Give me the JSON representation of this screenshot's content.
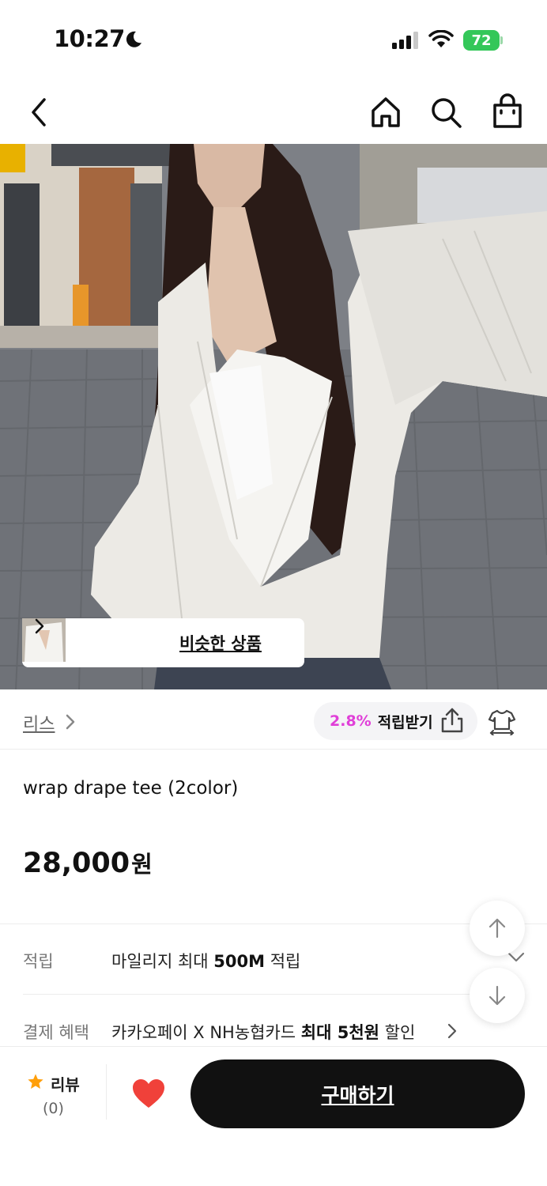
{
  "status_bar": {
    "time": "10:27",
    "battery": "72"
  },
  "nav": {
    "back_icon": "chevron-left-icon",
    "home_icon": "home-icon",
    "search_icon": "search-icon",
    "cart_icon": "shopping-bag-icon"
  },
  "hero": {
    "similar_label": "비슷한 상품"
  },
  "brand_row": {
    "brand": "리스",
    "reward_percent": "2.8%",
    "reward_label": "적립받기"
  },
  "product": {
    "title": "wrap drape tee (2color)",
    "price": "28,000",
    "currency": "원"
  },
  "info_rows": [
    {
      "key": "적립",
      "value_pre": "마일리지 최대 ",
      "value_bold": "500M",
      "value_post": " 적립"
    },
    {
      "key": "결제 혜택",
      "value_pre": "카카오페이 X NH농협카드 ",
      "value_bold": "최대 5천원",
      "value_post": " 할인"
    }
  ],
  "bottom_bar": {
    "review_label": "리뷰",
    "review_count": "(0)",
    "buy_label": "구매하기"
  },
  "colors": {
    "accent_pink": "#e03fd8",
    "heart_red": "#f0413a",
    "star_orange": "#ff9f0a",
    "buy_button": "#111111"
  }
}
